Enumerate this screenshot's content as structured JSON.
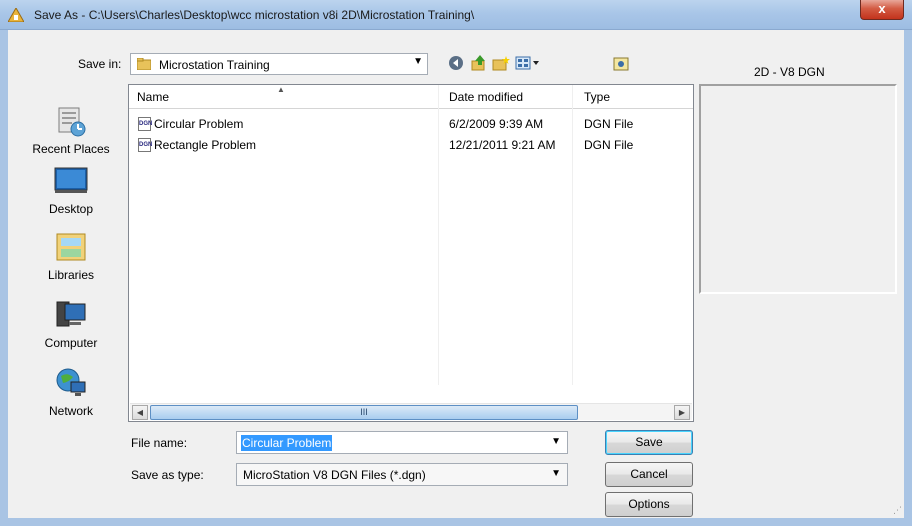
{
  "window": {
    "title": "Save As - C:\\Users\\Charles\\Desktop\\wcc microstation v8i 2D\\Microstation Training\\",
    "close_label": "x"
  },
  "toolbar": {
    "save_in_label": "Save in:",
    "save_in_value": "Microstation Training",
    "preview_title": "2D - V8 DGN"
  },
  "places": [
    {
      "label": "Recent Places",
      "icon": "recent-places-icon"
    },
    {
      "label": "Desktop",
      "icon": "desktop-icon"
    },
    {
      "label": "Libraries",
      "icon": "libraries-icon"
    },
    {
      "label": "Computer",
      "icon": "computer-icon"
    },
    {
      "label": "Network",
      "icon": "network-icon"
    }
  ],
  "file_list": {
    "columns": [
      "Name",
      "Date modified",
      "Type"
    ],
    "rows": [
      {
        "name": "Circular Problem",
        "date": "6/2/2009 9:39 AM",
        "type": "DGN File",
        "icon_text": "DGN"
      },
      {
        "name": "Rectangle Problem",
        "date": "12/21/2011 9:21 AM",
        "type": "DGN File",
        "icon_text": "DGN"
      }
    ],
    "scroll_thumb_label": "III"
  },
  "form": {
    "file_name_label": "File name:",
    "file_name_value": "Circular Problem",
    "save_type_label": "Save as type:",
    "save_type_value": "MicroStation V8 DGN Files (*.dgn)"
  },
  "buttons": {
    "save": "Save",
    "cancel": "Cancel",
    "options": "Options"
  },
  "colors": {
    "selection": "#3399ff",
    "title_bar": "#a9c6e8",
    "close_button": "#c3331c"
  }
}
